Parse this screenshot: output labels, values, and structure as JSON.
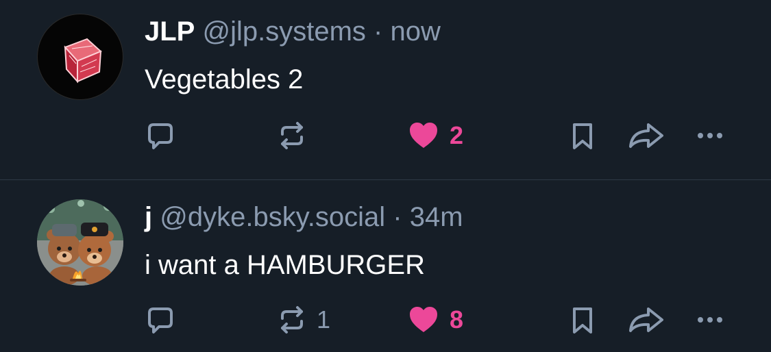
{
  "colors": {
    "background": "#161e27",
    "muted": "#8b9bb0",
    "like": "#ec4899",
    "divider": "#2e3945"
  },
  "posts": [
    {
      "author": {
        "display_name": "JLP",
        "handle": "@jlp.systems",
        "avatar": "red-cube-avatar"
      },
      "separator": "·",
      "time": "now",
      "text": "Vegetables 2",
      "actions": {
        "reply_count": "",
        "repost_count": "",
        "like_count": "2",
        "liked": true
      }
    },
    {
      "author": {
        "display_name": "j",
        "handle": "@dyke.bsky.social",
        "avatar": "bears-campfire-avatar"
      },
      "separator": "·",
      "time": "34m",
      "text": "i want a HAMBURGER",
      "actions": {
        "reply_count": "",
        "repost_count": "1",
        "like_count": "8",
        "liked": true
      }
    }
  ]
}
